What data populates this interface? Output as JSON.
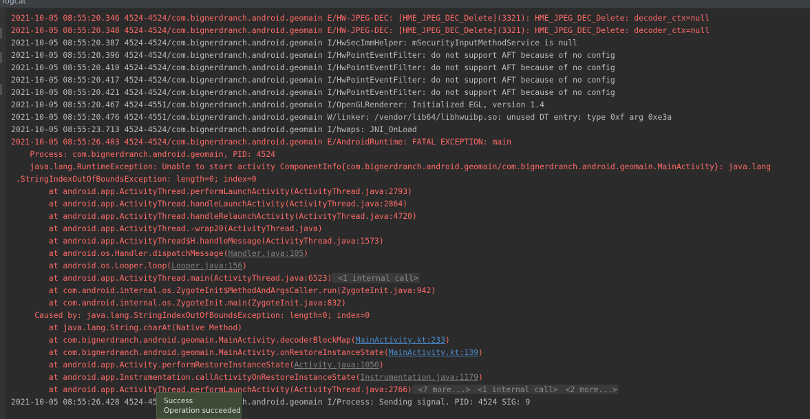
{
  "window": {
    "title": "logcat"
  },
  "log_lines": [
    {
      "level": "E",
      "text": "2021-10-05 08:55:20.346 4524-4524/com.bignerdranch.android.geomain E/HW-JPEG-DEC: [HME_JPEG_DEC_Delete](3321): HME_JPEG_DEC_Delete: decoder_ctx=null"
    },
    {
      "level": "E",
      "text": "2021-10-05 08:55:20.348 4524-4524/com.bignerdranch.android.geomain E/HW-JPEG-DEC: [HME_JPEG_DEC_Delete](3321): HME_JPEG_DEC_Delete: decoder_ctx=null"
    },
    {
      "level": "I",
      "text": "2021-10-05 08:55:20.387 4524-4524/com.bignerdranch.android.geomain I/HwSecImmHelper: mSecurityInputMethodService is null"
    },
    {
      "level": "I",
      "text": "2021-10-05 08:55:20.396 4524-4524/com.bignerdranch.android.geomain I/HwPointEventFilter: do not support AFT because of no config"
    },
    {
      "level": "I",
      "text": "2021-10-05 08:55:20.410 4524-4524/com.bignerdranch.android.geomain I/HwPointEventFilter: do not support AFT because of no config"
    },
    {
      "level": "I",
      "text": "2021-10-05 08:55:20.417 4524-4524/com.bignerdranch.android.geomain I/HwPointEventFilter: do not support AFT because of no config"
    },
    {
      "level": "I",
      "text": "2021-10-05 08:55:20.421 4524-4524/com.bignerdranch.android.geomain I/HwPointEventFilter: do not support AFT because of no config"
    },
    {
      "level": "I",
      "text": "2021-10-05 08:55:20.467 4524-4551/com.bignerdranch.android.geomain I/OpenGLRenderer: Initialized EGL, version 1.4"
    },
    {
      "level": "W",
      "text": "2021-10-05 08:55:20.476 4524-4551/com.bignerdranch.android.geomain W/linker: /vendor/lib64/libhwuibp.so: unused DT entry: type 0xf arg 0xe3a"
    },
    {
      "level": "I",
      "text": "2021-10-05 08:55:23.713 4524-4524/com.bignerdranch.android.geomain I/hwaps: JNI_OnLoad"
    },
    {
      "level": "E",
      "text": "2021-10-05 08:55:26.403 4524-4524/com.bignerdranch.android.geomain E/AndroidRuntime: FATAL EXCEPTION: main"
    },
    {
      "level": "E",
      "text": "    Process: com.bignerdranch.android.geomain, PID: 4524"
    },
    {
      "level": "E",
      "text": "    java.lang.RuntimeException: Unable to start activity ComponentInfo{com.bignerdranch.android.geomain/com.bignerdranch.android.geomain.MainActivity}: java.lang"
    },
    {
      "level": "E",
      "text": " .StringIndexOutOfBoundsException: length=0; index=0"
    },
    {
      "level": "E",
      "text": "        at android.app.ActivityThread.performLaunchActivity(ActivityThread.java:2793)"
    },
    {
      "level": "E",
      "text": "        at android.app.ActivityThread.handleLaunchActivity(ActivityThread.java:2864)"
    },
    {
      "level": "E",
      "text": "        at android.app.ActivityThread.handleRelaunchActivity(ActivityThread.java:4720)"
    },
    {
      "level": "E",
      "text": "        at android.app.ActivityThread.-wrap20(ActivityThread.java)"
    },
    {
      "level": "E",
      "text": "        at android.app.ActivityThread$H.handleMessage(ActivityThread.java:1573)"
    },
    {
      "level": "E",
      "text": "        at android.os.Handler.dispatchMessage(",
      "link": "Handler.java:105",
      "link_style": "gray",
      "suffix": ")"
    },
    {
      "level": "E",
      "text": "        at android.os.Looper.loop(",
      "link": "Looper.java:156",
      "link_style": "gray",
      "suffix": ")"
    },
    {
      "level": "E",
      "text": "        at android.app.ActivityThread.main(ActivityThread.java:6523)",
      "folds": [
        " <1 internal call>"
      ],
      "expander": true
    },
    {
      "level": "E",
      "text": "        at com.android.internal.os.ZygoteInit$MethodAndArgsCaller.run(ZygoteInit.java:942)"
    },
    {
      "level": "E",
      "text": "        at com.android.internal.os.ZygoteInit.main(ZygoteInit.java:832)"
    },
    {
      "level": "E",
      "text": "     Caused by: java.lang.StringIndexOutOfBoundsException: length=0; index=0"
    },
    {
      "level": "E",
      "text": "        at java.lang.String.charAt(Native Method)"
    },
    {
      "level": "E",
      "text": "        at com.bignerdranch.android.geomain.MainActivity.decoderBlockMap(",
      "link": "MainActivity.kt:233",
      "link_style": "blue",
      "suffix": ")"
    },
    {
      "level": "E",
      "text": "        at com.bignerdranch.android.geomain.MainActivity.onRestoreInstanceState(",
      "link": "MainActivity.kt:139",
      "link_style": "blue",
      "suffix": ")"
    },
    {
      "level": "E",
      "text": "        at android.app.Activity.performRestoreInstanceState(",
      "link": "Activity.java:1050",
      "link_style": "gray",
      "suffix": ")"
    },
    {
      "level": "E",
      "text": "        at android.app.Instrumentation.callActivityOnRestoreInstanceState(",
      "link": "Instrumentation.java:1179",
      "link_style": "gray",
      "suffix": ")"
    },
    {
      "level": "E",
      "text": "        at android.app.ActivityThread.performLaunchActivity(ActivityThread.java:2766)",
      "folds": [
        " <7 more...>",
        " <1 internal call>",
        " <2 more...>"
      ],
      "expander": true
    },
    {
      "level": "I",
      "text": "2021-10-05 08:55:26.428 4524-4524/com.bignerdranch.android.geomain I/Process: Sending signal. PID: 4524 SIG: 9"
    }
  ],
  "toast": {
    "title": "Success",
    "message": "Operation succeeded"
  },
  "colors": {
    "background": "#2b2b2b",
    "error": "#ff6b68",
    "info": "#bbbbbb",
    "link_blue": "#4a88c7",
    "toast_bg": "#3d4b36"
  }
}
